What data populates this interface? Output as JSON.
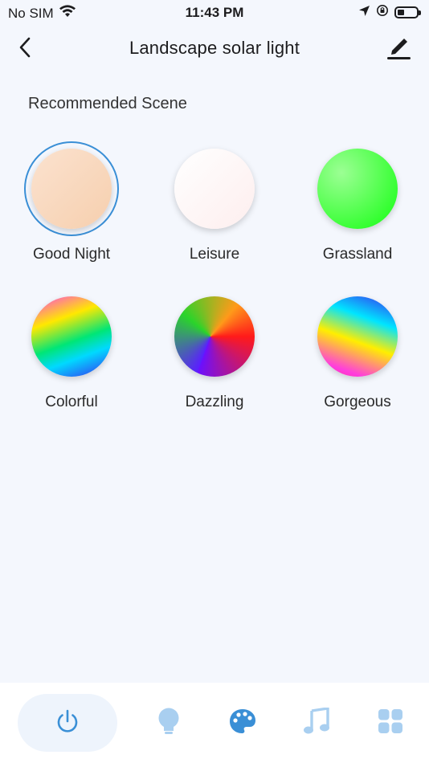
{
  "status_bar": {
    "carrier": "No SIM",
    "time": "11:43 PM",
    "battery_level": 0.35
  },
  "header": {
    "title": "Landscape solar light"
  },
  "section": {
    "title": "Recommended Scene"
  },
  "scenes": [
    {
      "label": "Good Night",
      "selected": true
    },
    {
      "label": "Leisure",
      "selected": false
    },
    {
      "label": "Grassland",
      "selected": false
    },
    {
      "label": "Colorful",
      "selected": false
    },
    {
      "label": "Dazzling",
      "selected": false
    },
    {
      "label": "Gorgeous",
      "selected": false
    }
  ],
  "bottom_nav": {
    "items": [
      {
        "icon": "power-icon",
        "active": false
      },
      {
        "icon": "bulb-icon",
        "active": false
      },
      {
        "icon": "palette-icon",
        "active": true
      },
      {
        "icon": "music-note-icon",
        "active": false
      },
      {
        "icon": "grid-icon",
        "active": false
      }
    ]
  },
  "colors": {
    "accent": "#3a8fd6",
    "inactive_icon": "#a9cff0",
    "background": "#f4f7fd"
  }
}
